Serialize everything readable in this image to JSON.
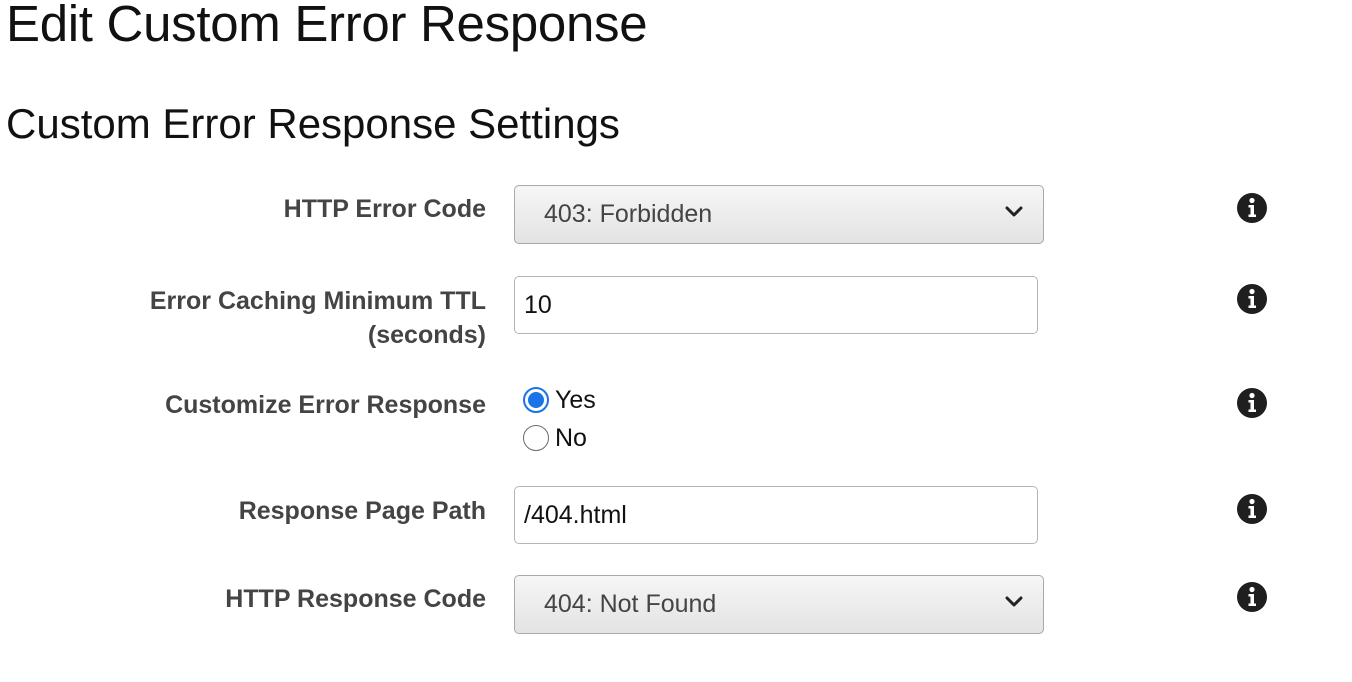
{
  "page": {
    "title": "Edit Custom Error Response"
  },
  "section": {
    "title": "Custom Error Response Settings"
  },
  "fields": {
    "http_error_code": {
      "label": "HTTP Error Code",
      "value": "403: Forbidden"
    },
    "error_caching_ttl": {
      "label_line1": "Error Caching Minimum TTL",
      "label_line2": "(seconds)",
      "value": "10"
    },
    "customize_error_response": {
      "label": "Customize Error Response",
      "options": [
        "Yes",
        "No"
      ],
      "selected": "Yes"
    },
    "response_page_path": {
      "label": "Response Page Path",
      "value": "/404.html"
    },
    "http_response_code": {
      "label": "HTTP Response Code",
      "value": "404: Not Found"
    }
  },
  "icons": {
    "info": "info-icon",
    "dropdown": "chevron-down-icon"
  },
  "colors": {
    "radio_accent": "#1a73e8",
    "label_text": "#444444",
    "info_icon": "#1f1f1f"
  }
}
